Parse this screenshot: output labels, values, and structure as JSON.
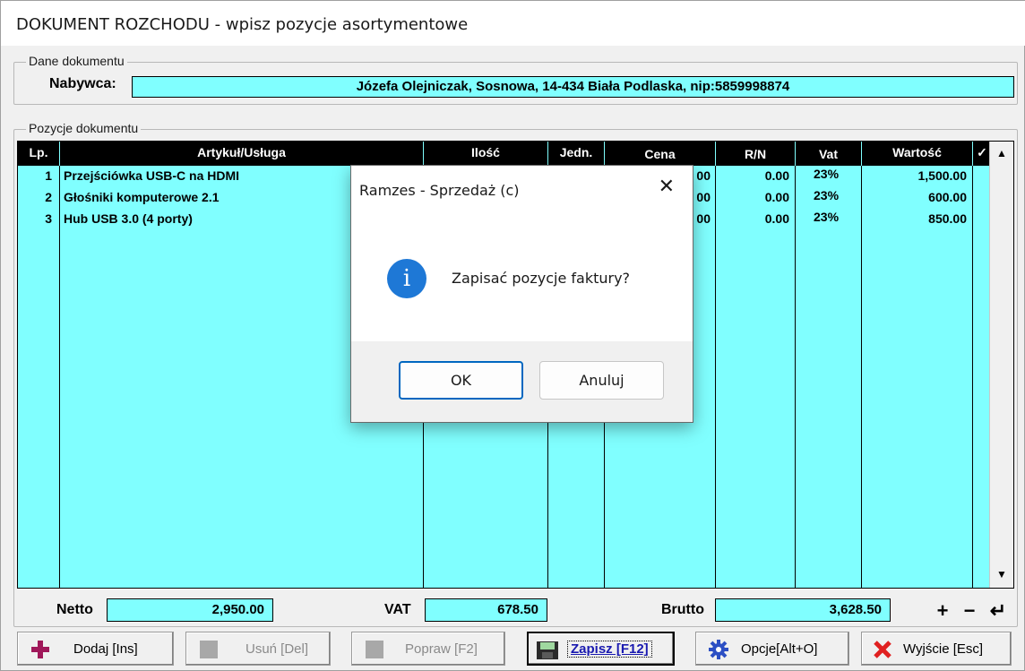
{
  "window": {
    "title": "DOKUMENT ROZCHODU - wpisz pozycje asortymentowe"
  },
  "dane": {
    "group_label": "Dane dokumentu",
    "nabywca_label": "Nabywca:",
    "nabywca_value": "Józefa Olejniczak,  Sosnowa,  14-434 Biała Podlaska,  nip:5859998874"
  },
  "pozycje": {
    "group_label": "Pozycje dokumentu",
    "columns": [
      "Lp.",
      "Artykuł/Usługa",
      "Ilość",
      "Jedn.",
      "Cena",
      "R/N",
      "Vat",
      "Wartość",
      "✓"
    ],
    "rows": [
      {
        "lp": "1",
        "name": "Przejściówka USB-C na HDMI",
        "cena_tail": "00",
        "rn": "0.00",
        "vat": "23%",
        "wartosc": "1,500.00"
      },
      {
        "lp": "2",
        "name": "Głośniki komputerowe 2.1",
        "cena_tail": "00",
        "rn": "0.00",
        "vat": "23%",
        "wartosc": "600.00"
      },
      {
        "lp": "3",
        "name": "Hub USB 3.0 (4 porty)",
        "cena_tail": "00",
        "rn": "0.00",
        "vat": "23%",
        "wartosc": "850.00"
      }
    ]
  },
  "totals": {
    "netto_label": "Netto",
    "netto_value": "2,950.00",
    "vat_label": "VAT",
    "vat_value": "678.50",
    "brutto_label": "Brutto",
    "brutto_value": "3,628.50"
  },
  "buttons": {
    "dodaj": "Dodaj  [Ins]",
    "usun": "Usuń  [Del]",
    "popraw": "Popraw  [F2]",
    "zapisz": "Zapisz  [F12]",
    "opcje": "Opcje[Alt+O]",
    "wyjscie": "Wyjście  [Esc]"
  },
  "dialog": {
    "title": "Ramzes - Sprzedaż (c)",
    "message": "Zapisać pozycje faktury?",
    "ok": "OK",
    "cancel": "Anuluj"
  },
  "colors": {
    "grid_bg": "#80ffff",
    "header_bg": "#000000",
    "info_blue": "#1e78d6"
  }
}
